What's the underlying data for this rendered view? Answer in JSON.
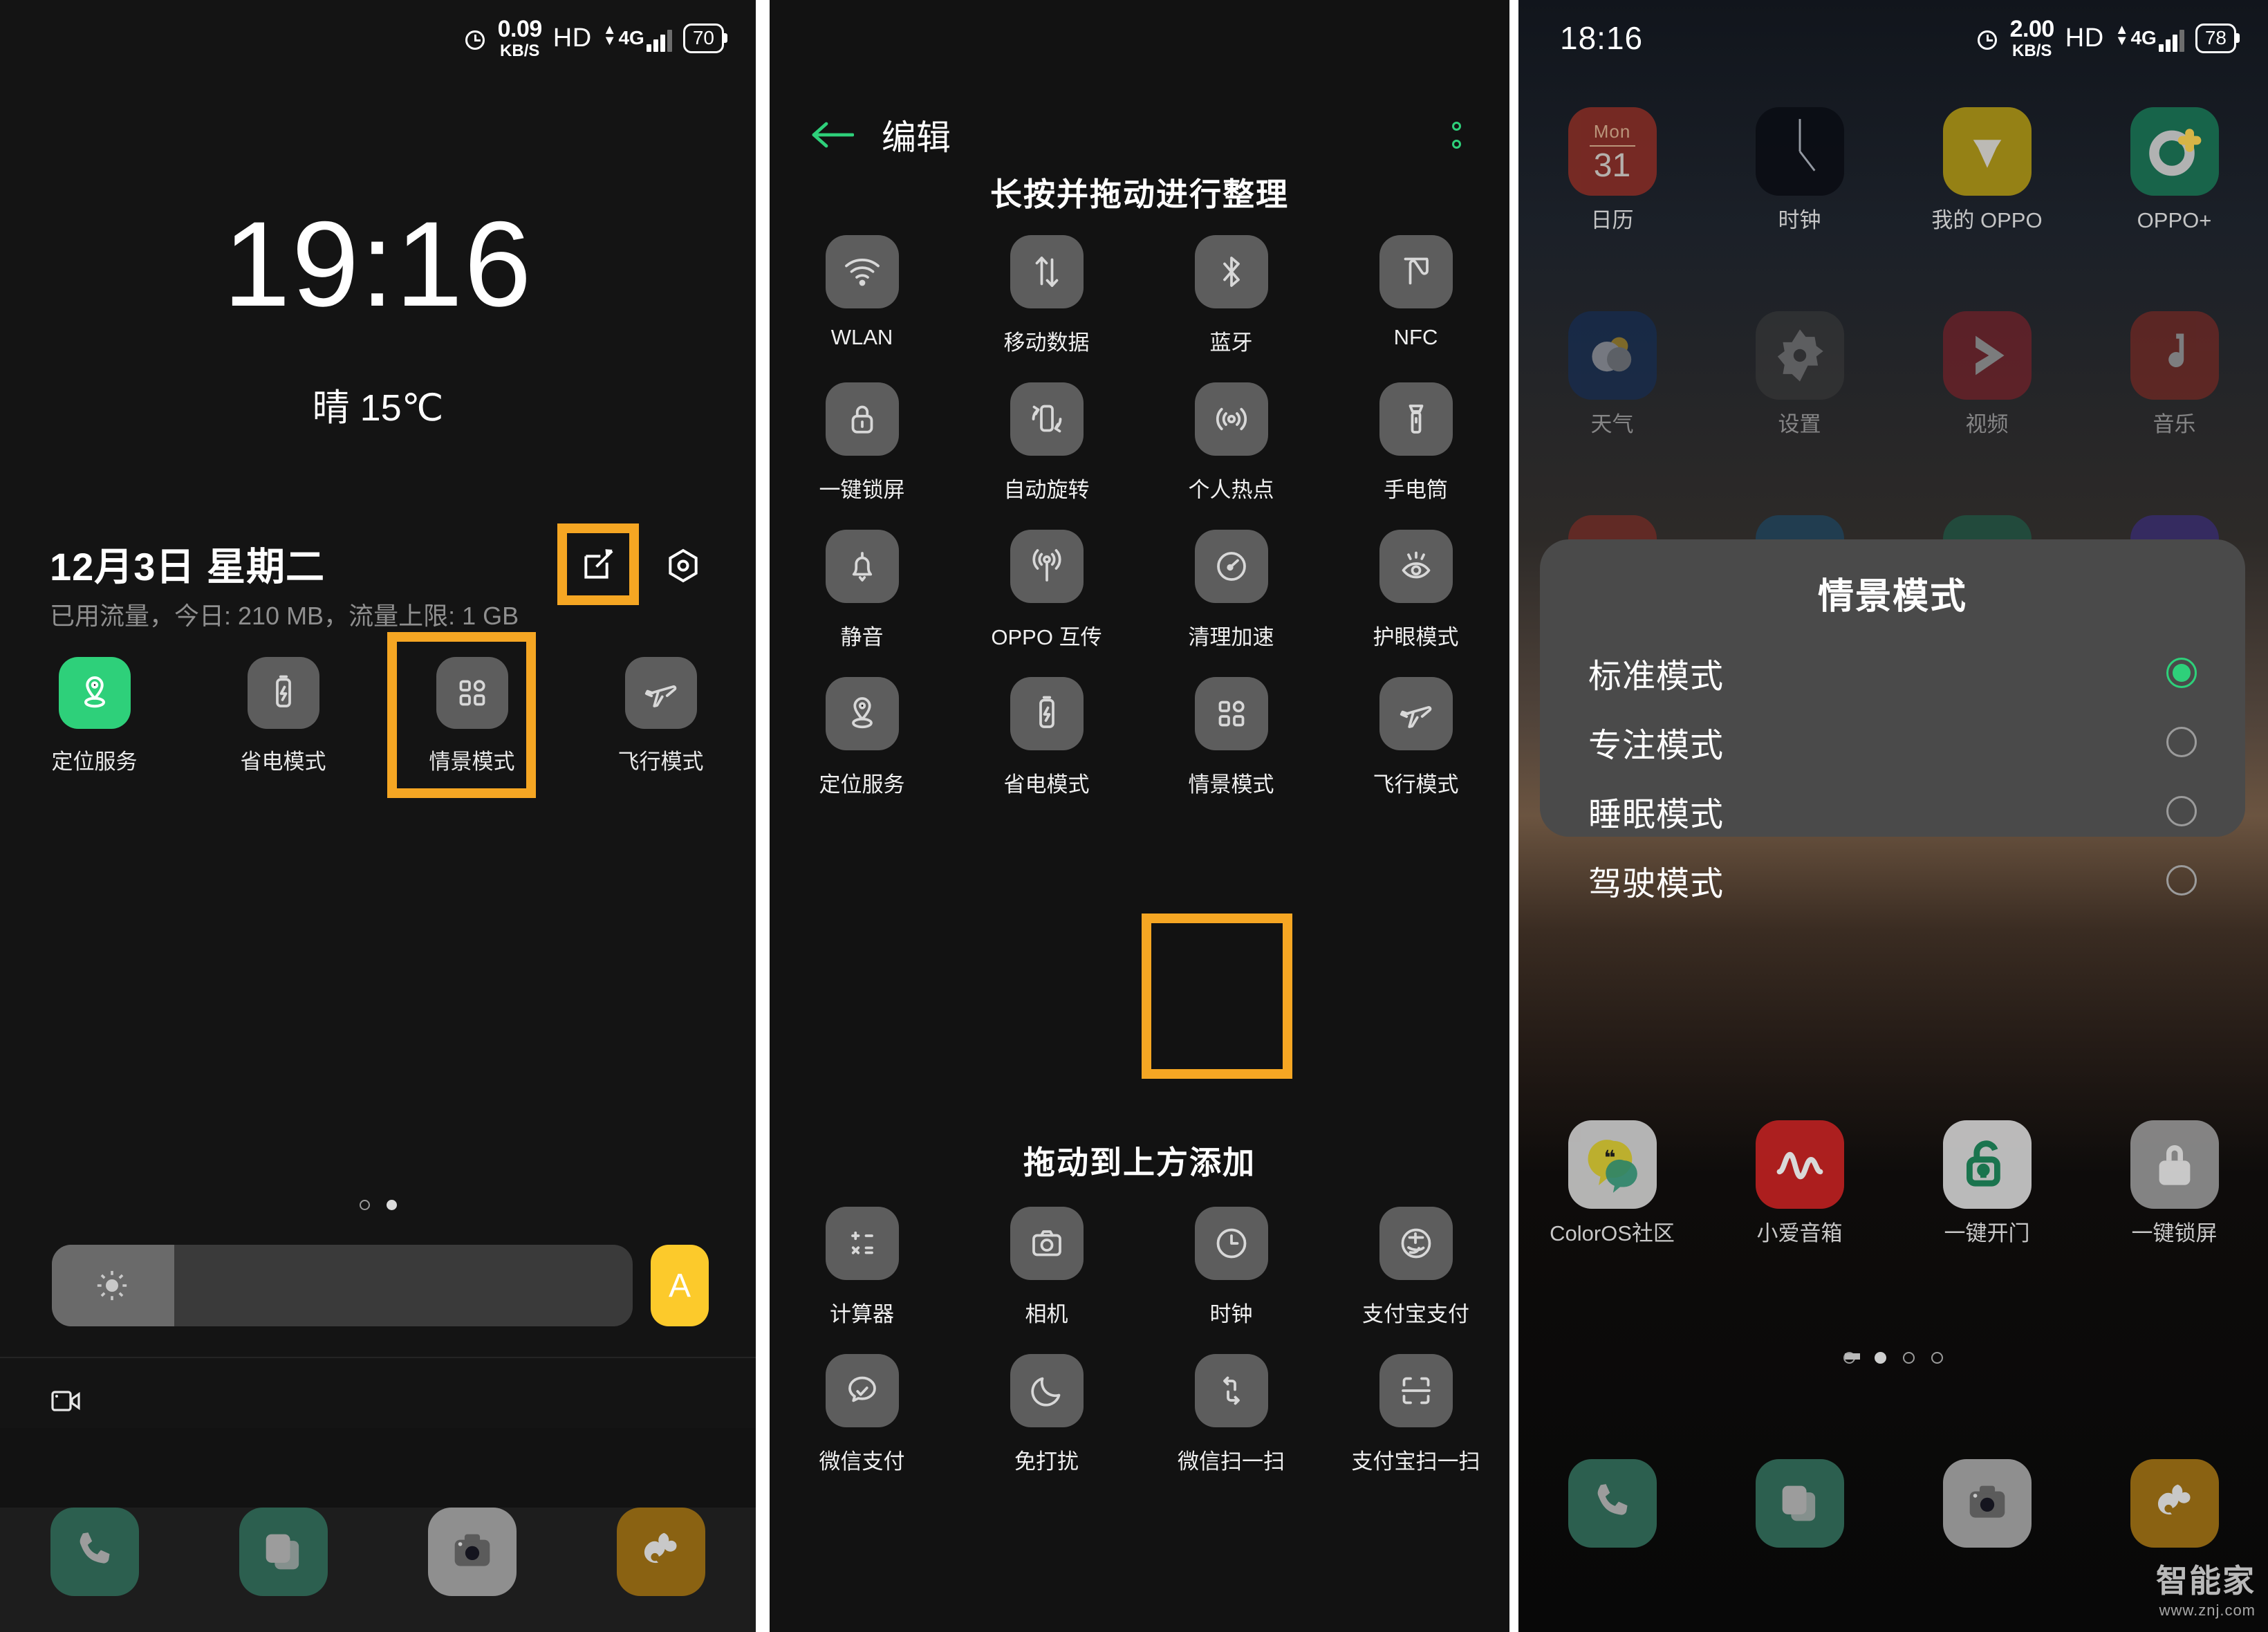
{
  "panel1": {
    "statusbar": {
      "alarm_icon": "alarm-icon",
      "net_speed_value": "0.09",
      "net_speed_unit": "KB/S",
      "hd": "HD",
      "network_type": "4G",
      "battery": "70"
    },
    "clock": "19:16",
    "weather": "晴 15℃",
    "date": "12月3日  星期二",
    "data_usage": "已用流量，今日: 210 MB，流量上限: 1 GB",
    "edit_button_icon": "edit-icon",
    "target_button_icon": "target-icon",
    "tiles": [
      {
        "label": "定位服务",
        "icon": "location-icon",
        "on": true
      },
      {
        "label": "省电模式",
        "icon": "battery-saver-icon",
        "on": false
      },
      {
        "label": "情景模式",
        "icon": "scene-mode-icon",
        "on": false
      },
      {
        "label": "飞行模式",
        "icon": "airplane-icon",
        "on": false
      }
    ],
    "page_dots": 2,
    "page_active": 1,
    "brightness_icon": "brightness-icon",
    "auto_brightness_label": "A",
    "cast_icon": "screen-cast-icon",
    "dock": [
      {
        "name": "电话",
        "icon": "phone-icon"
      },
      {
        "name": "信息",
        "icon": "messages-icon"
      },
      {
        "name": "相机",
        "icon": "camera-icon"
      },
      {
        "name": "UC浏览器",
        "icon": "uc-browser-icon"
      }
    ]
  },
  "panel2": {
    "back_icon": "back-arrow-icon",
    "title": "编辑",
    "more_icon": "more-vertical-icon",
    "section_top": "长按并拖动进行整理",
    "section_bottom": "拖动到上方添加",
    "active_tiles": [
      {
        "label": "WLAN",
        "icon": "wifi-icon"
      },
      {
        "label": "移动数据",
        "icon": "mobile-data-icon"
      },
      {
        "label": "蓝牙",
        "icon": "bluetooth-icon"
      },
      {
        "label": "NFC",
        "icon": "nfc-icon"
      },
      {
        "label": "一键锁屏",
        "icon": "lock-icon"
      },
      {
        "label": "自动旋转",
        "icon": "auto-rotate-icon"
      },
      {
        "label": "个人热点",
        "icon": "hotspot-icon"
      },
      {
        "label": "手电筒",
        "icon": "flashlight-icon"
      },
      {
        "label": "静音",
        "icon": "bell-icon"
      },
      {
        "label": "OPPO 互传",
        "icon": "oppo-share-icon"
      },
      {
        "label": "清理加速",
        "icon": "speed-clean-icon"
      },
      {
        "label": "护眼模式",
        "icon": "eye-care-icon"
      },
      {
        "label": "定位服务",
        "icon": "location-icon"
      },
      {
        "label": "省电模式",
        "icon": "battery-saver-icon"
      },
      {
        "label": "情景模式",
        "icon": "scene-mode-icon"
      },
      {
        "label": "飞行模式",
        "icon": "airplane-icon"
      }
    ],
    "available_tiles": [
      {
        "label": "计算器",
        "icon": "calculator-icon"
      },
      {
        "label": "相机",
        "icon": "camera-icon"
      },
      {
        "label": "时钟",
        "icon": "clock-icon"
      },
      {
        "label": "支付宝支付",
        "icon": "alipay-pay-icon"
      },
      {
        "label": "微信支付",
        "icon": "wechat-pay-icon"
      },
      {
        "label": "免打扰",
        "icon": "do-not-disturb-icon"
      },
      {
        "label": "微信扫一扫",
        "icon": "wechat-scan-icon"
      },
      {
        "label": "支付宝扫一扫",
        "icon": "alipay-scan-icon"
      }
    ]
  },
  "panel3": {
    "statusbar": {
      "clock": "18:16",
      "alarm_icon": "alarm-icon",
      "net_speed_value": "2.00",
      "net_speed_unit": "KB/S",
      "hd": "HD",
      "network_type": "4G",
      "battery": "78"
    },
    "apps_row1": [
      {
        "label": "日历",
        "icon": "calendar-icon",
        "badge_day": "Mon",
        "badge_date": "31"
      },
      {
        "label": "时钟",
        "icon": "clock-app-icon"
      },
      {
        "label": "我的 OPPO",
        "icon": "my-oppo-icon"
      },
      {
        "label": "OPPO+",
        "icon": "oppo-plus-icon"
      }
    ],
    "apps_row2": [
      {
        "label": "天气",
        "icon": "weather-icon"
      },
      {
        "label": "设置",
        "icon": "settings-icon"
      },
      {
        "label": "视频",
        "icon": "video-icon"
      },
      {
        "label": "音乐",
        "icon": "music-icon"
      }
    ],
    "apps_row4": [
      {
        "label": "ColorOS社区",
        "icon": "coloros-community-icon"
      },
      {
        "label": "小爱音箱",
        "icon": "xiaoai-speaker-icon"
      },
      {
        "label": "一键开门",
        "icon": "one-key-unlock-icon"
      },
      {
        "label": "一键锁屏",
        "icon": "one-key-lock-icon"
      }
    ],
    "page_dots": 3,
    "page_active": 0,
    "dialog": {
      "title": "情景模式",
      "options": [
        {
          "label": "标准模式",
          "selected": true
        },
        {
          "label": "专注模式",
          "selected": false
        },
        {
          "label": "睡眠模式",
          "selected": false
        },
        {
          "label": "驾驶模式",
          "selected": false
        }
      ]
    },
    "dock": [
      {
        "name": "电话",
        "icon": "phone-icon"
      },
      {
        "name": "信息",
        "icon": "messages-icon"
      },
      {
        "name": "相机",
        "icon": "camera-icon"
      },
      {
        "name": "UC浏览器",
        "icon": "uc-browser-icon"
      }
    ],
    "watermark": {
      "line1": "智能家",
      "line2": "www.znj.com"
    }
  },
  "colors": {
    "highlight": "#F5A623",
    "accent_green": "#2ED07A",
    "auto_yellow": "#FCCA2B",
    "tile_bg": "#5D5D5D"
  }
}
